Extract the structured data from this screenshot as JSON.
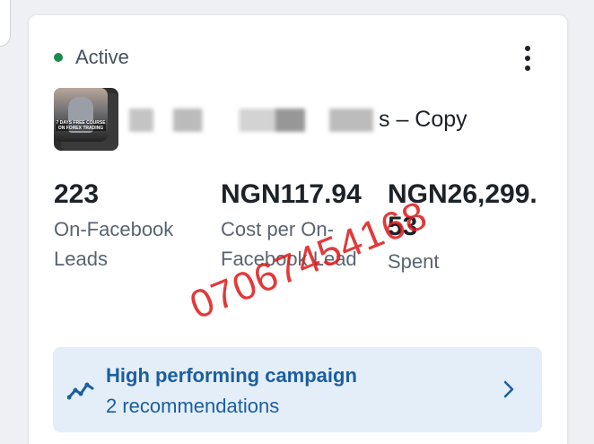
{
  "status": {
    "label": "Active",
    "color": "#1d8a4f"
  },
  "menu": {
    "icon": "more-vertical-icon"
  },
  "campaign": {
    "thumbnail_caption": "7 DAYS FREE COURSE ON FOREX TRADING",
    "name_visible_suffix": "s – Copy"
  },
  "metrics": [
    {
      "value": "223",
      "label": "On-Facebook Leads"
    },
    {
      "value": "NGN117.94",
      "label": "Cost per On-Facebook Lead"
    },
    {
      "value": "NGN26,299.53",
      "label": "Spent"
    }
  ],
  "recommendation": {
    "title": "High performing campaign",
    "subtitle": "2 recommendations",
    "icon": "trend-icon",
    "accent": "#1b5e9f",
    "background": "#e4eef8"
  },
  "watermark": "07067454168"
}
